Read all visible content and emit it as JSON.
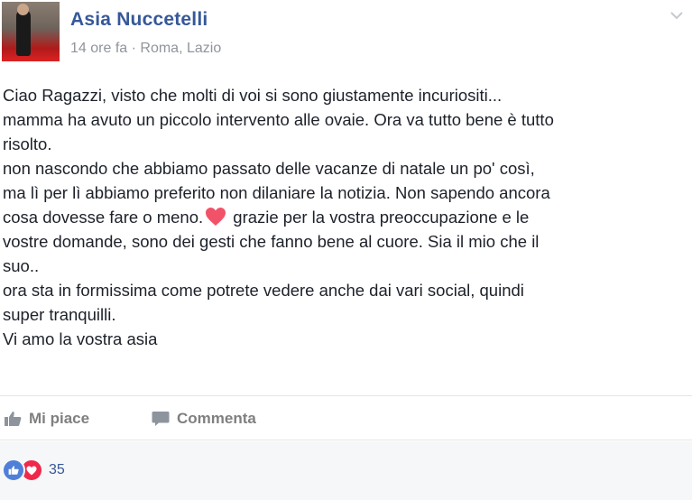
{
  "post": {
    "author": "Asia Nuccetelli",
    "time": "14 ore fa",
    "separator": "·",
    "location": "Roma, Lazio",
    "text_before_heart": "Ciao Ragazzi, visto che molti di voi si sono giustamente incuriositi...\nmamma ha avuto un piccolo intervento alle ovaie. Ora va tutto bene è tutto\nrisolto.\nnon nascondo che abbiamo passato delle vacanze di natale un po' così,\nma lì per lì abbiamo preferito non dilaniare la notizia. Non sapendo ancora\ncosa dovesse fare o meno.",
    "text_after_heart": " grazie per la vostra preoccupazione e le\nvostre domande, sono dei gesti che fanno bene al cuore. Sia il mio che il\nsuo..\nora sta in formissima come potrete vedere anche dai vari social, quindi\nsuper tranquilli.\nVi amo la vostra asia",
    "heart_color": "#f25268"
  },
  "actions": {
    "like_label": "Mi piace",
    "comment_label": "Commenta"
  },
  "reactions": {
    "icons": [
      "like-icon",
      "love-icon"
    ],
    "count": "35"
  },
  "colors": {
    "name": "#365899",
    "meta": "#90949c",
    "action": "#7f7f7f"
  }
}
